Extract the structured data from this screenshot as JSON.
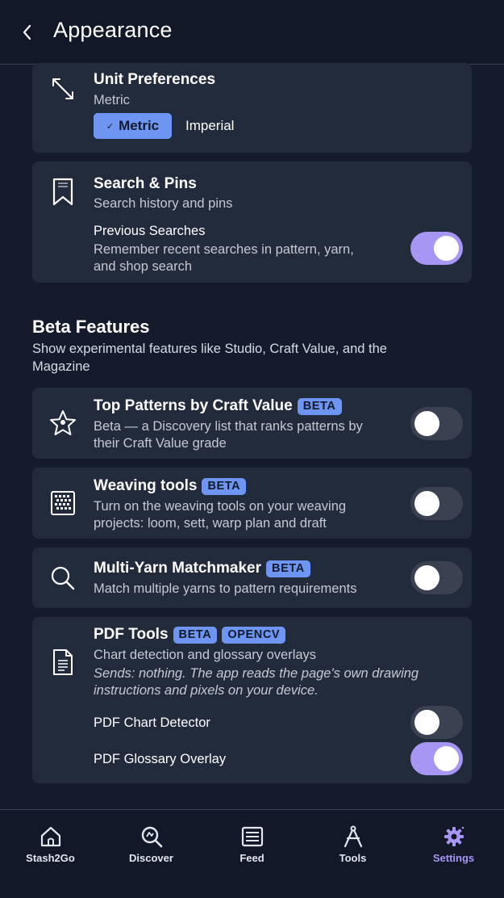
{
  "header": {
    "title": "Appearance"
  },
  "units": {
    "title": "Unit Preferences",
    "subtitle": "Metric",
    "options": [
      "Metric",
      "Imperial"
    ],
    "selected": "Metric"
  },
  "search": {
    "title": "Search & Pins",
    "subtitle": "Search history and pins",
    "setting_title": "Previous Searches",
    "setting_desc_1": "Remember recent searches in pattern, yarn,",
    "setting_desc_2": "and shop search",
    "enabled": true
  },
  "beta": {
    "title": "Beta Features",
    "subtitle_1": "Show experimental features like Studio, Craft Value, and the",
    "subtitle_2": "Magazine"
  },
  "features": [
    {
      "title": "Top Patterns by Craft Value",
      "badge": "BETA",
      "desc_1": "Beta — a Discovery list that ranks patterns by",
      "desc_2": "their Craft Value grade",
      "enabled": false
    },
    {
      "title": "Weaving tools",
      "badge": "BETA",
      "desc_1": "Turn on the weaving tools on your weaving",
      "desc_2": "projects: loom, sett, warp plan and draft",
      "enabled": false
    },
    {
      "title": "Multi-Yarn Matchmaker",
      "badge": "BETA",
      "desc_1": "Match multiple yarns to pattern requirements",
      "enabled": false
    }
  ],
  "pdf": {
    "title": "PDF Tools",
    "badges": [
      "BETA",
      "OPENCV"
    ],
    "desc": "Chart detection and glossary overlays",
    "note_1": "Sends: nothing. The app reads the page's own drawing",
    "note_2": "instructions and pixels on your device.",
    "settings": [
      {
        "label": "PDF Chart Detector",
        "enabled": false
      },
      {
        "label": "PDF Glossary Overlay",
        "enabled": true
      }
    ]
  },
  "nav": {
    "items": [
      {
        "label": "Stash2Go",
        "icon": "home-icon"
      },
      {
        "label": "Discover",
        "icon": "discover-icon"
      },
      {
        "label": "Feed",
        "icon": "feed-icon"
      },
      {
        "label": "Tools",
        "icon": "tools-icon"
      },
      {
        "label": "Settings",
        "icon": "gear-icon"
      }
    ],
    "active": "Settings"
  },
  "colors": {
    "background": "#141b2c",
    "card": "#222b3c",
    "accent_blue": "#6e95f2",
    "accent_purple": "#a796f3"
  }
}
